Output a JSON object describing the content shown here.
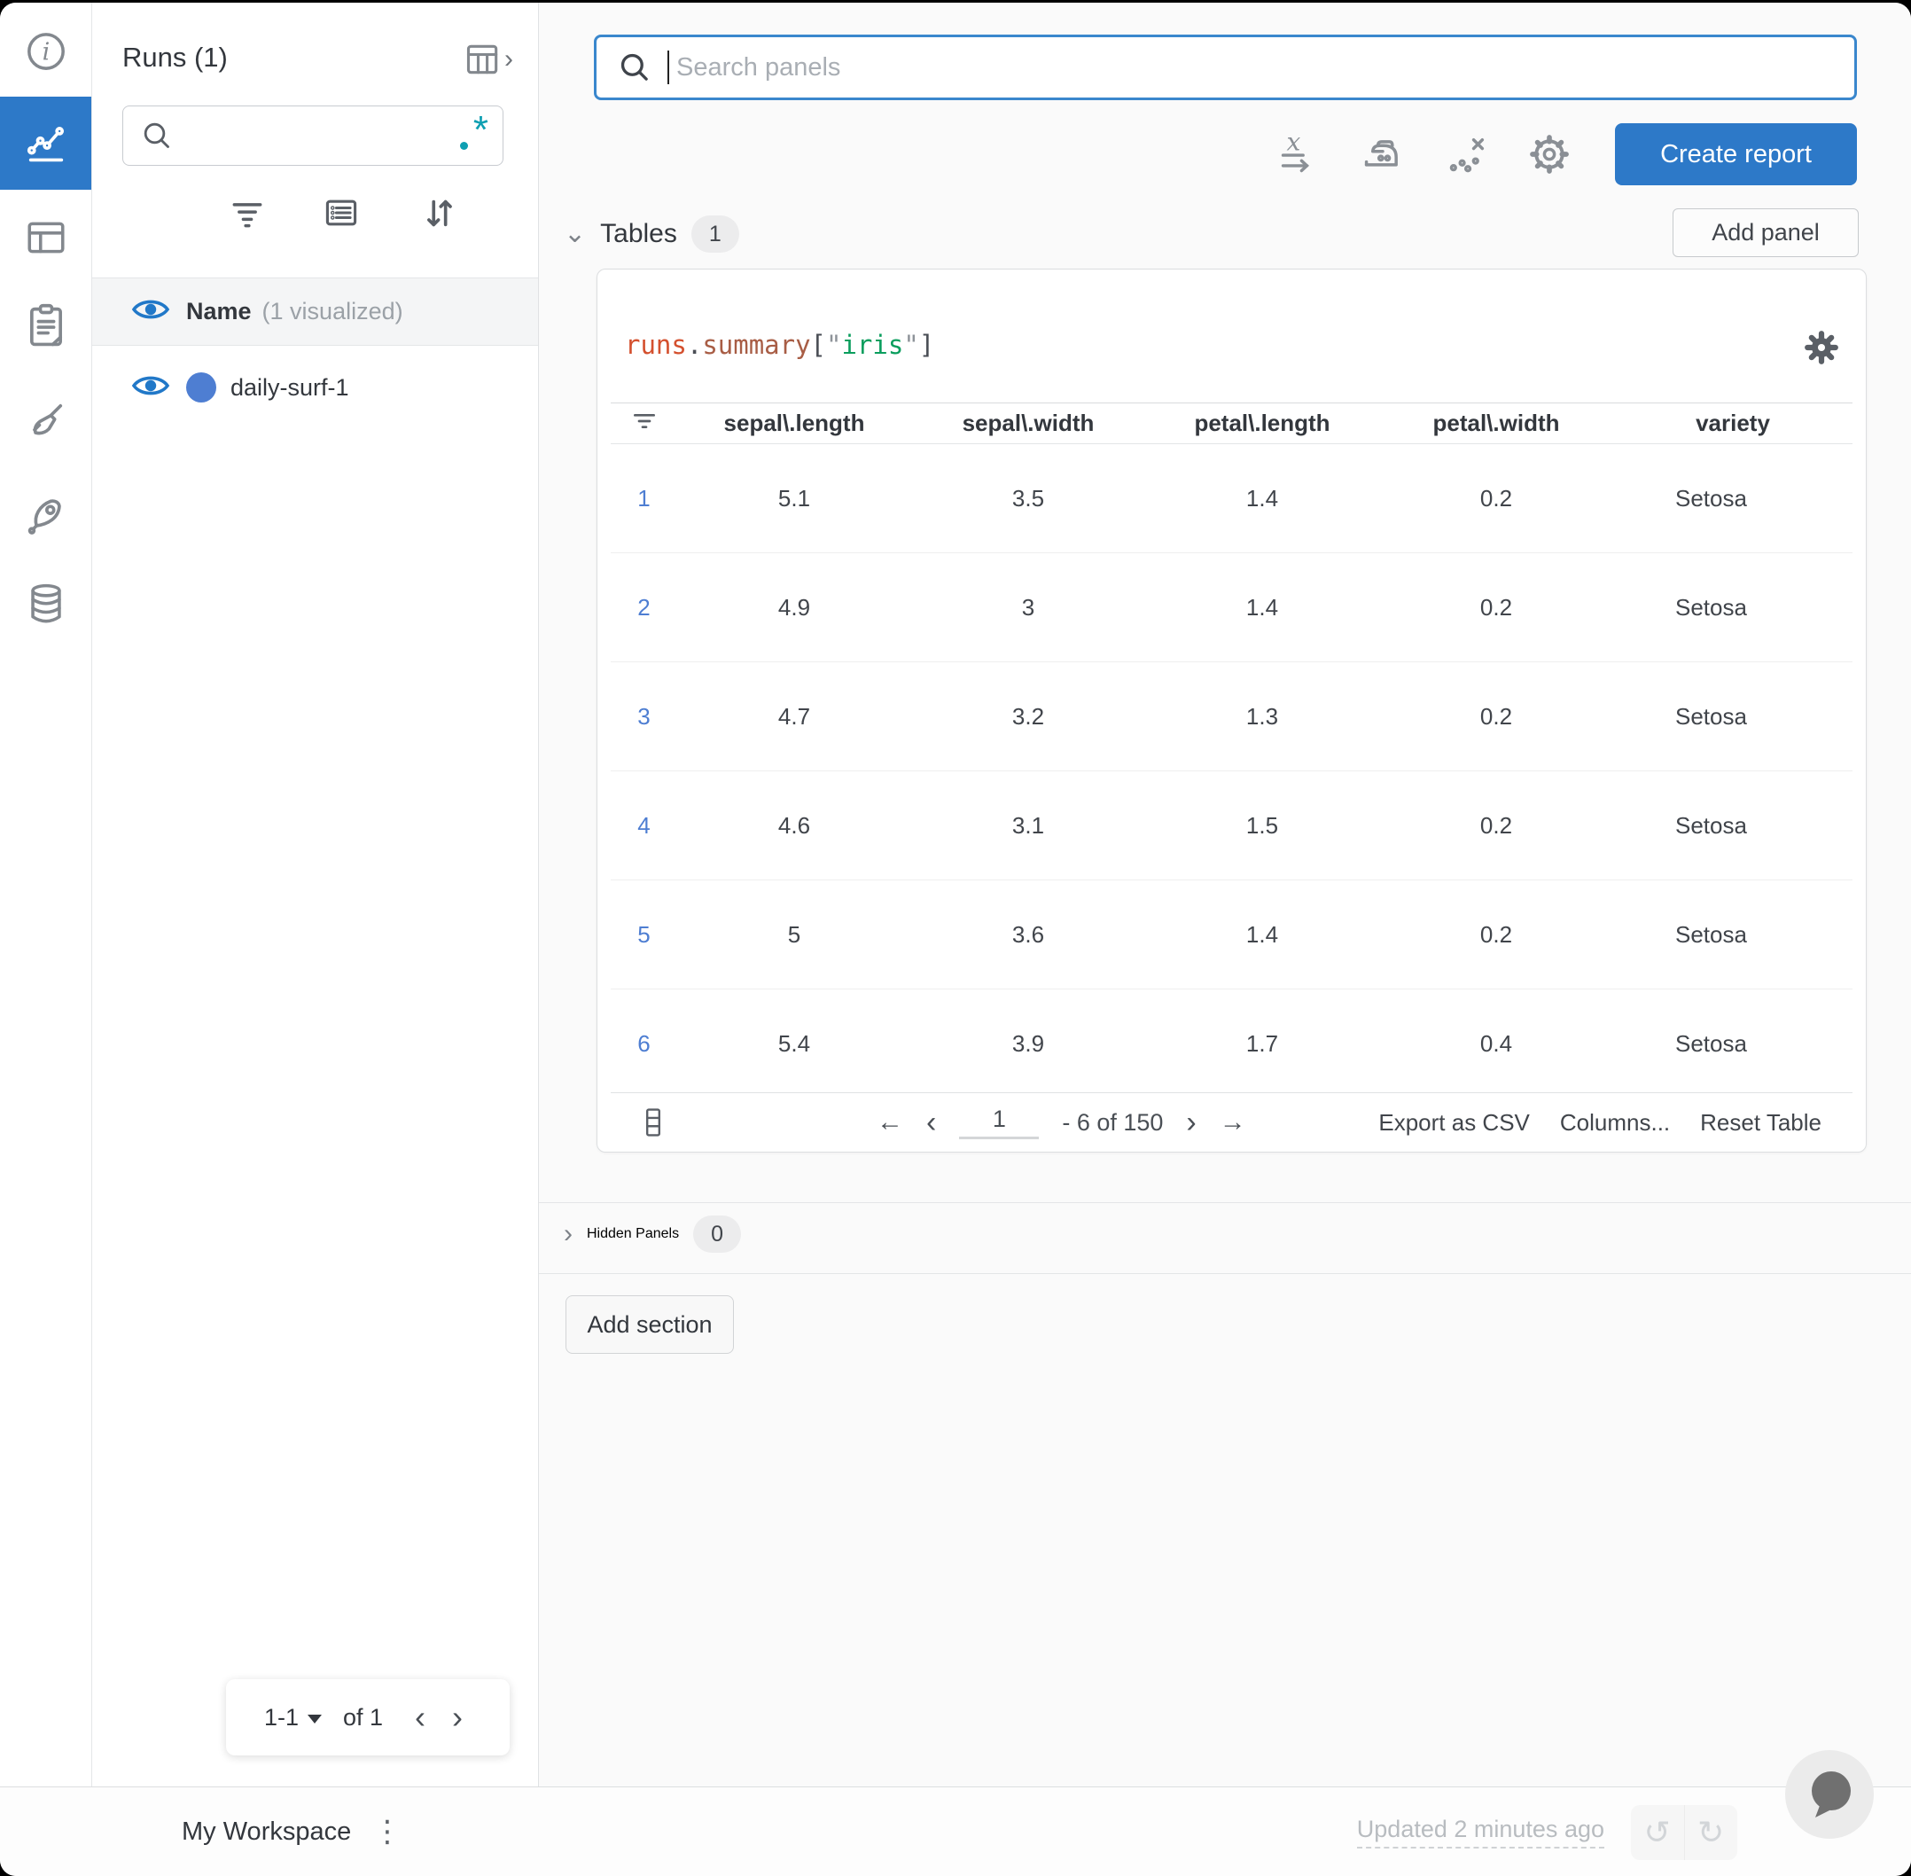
{
  "runs_panel": {
    "title": "Runs (1)",
    "search_value": "",
    "header": {
      "name_label": "Name",
      "visualized_label": "(1 visualized)"
    },
    "runs": [
      {
        "name": "daily-surf-1",
        "color": "#4e7ed2"
      }
    ],
    "pagination": {
      "range": "1-1",
      "of_label": "of 1",
      "prev": "‹",
      "next": "›"
    }
  },
  "toolbar": {
    "search_placeholder": "Search panels",
    "create_report_label": "Create report",
    "add_panel_label": "Add panel"
  },
  "sections": {
    "tables": {
      "label": "Tables",
      "count": "1",
      "chevron": "⌄"
    },
    "hidden": {
      "label": "Hidden Panels",
      "count": "0",
      "chevron": "›"
    },
    "add_section_label": "Add section"
  },
  "table_panel": {
    "title_parts": {
      "obj": "runs",
      "dot": ".",
      "prop": "summary",
      "lbracket": "[",
      "lq": "\"",
      "key": "iris",
      "rq": "\"",
      "rbracket": "]"
    },
    "columns": [
      "sepal\\.length",
      "sepal\\.width",
      "petal\\.length",
      "petal\\.width",
      "variety"
    ],
    "rows": [
      {
        "index": "1",
        "values": [
          "5.1",
          "3.5",
          "1.4",
          "0.2",
          "Setosa"
        ]
      },
      {
        "index": "2",
        "values": [
          "4.9",
          "3",
          "1.4",
          "0.2",
          "Setosa"
        ]
      },
      {
        "index": "3",
        "values": [
          "4.7",
          "3.2",
          "1.3",
          "0.2",
          "Setosa"
        ]
      },
      {
        "index": "4",
        "values": [
          "4.6",
          "3.1",
          "1.5",
          "0.2",
          "Setosa"
        ]
      },
      {
        "index": "5",
        "values": [
          "5",
          "3.6",
          "1.4",
          "0.2",
          "Setosa"
        ]
      },
      {
        "index": "6",
        "values": [
          "5.4",
          "3.9",
          "1.7",
          "0.4",
          "Setosa"
        ]
      }
    ],
    "pagination": {
      "page": "1",
      "range_label": "- 6 of 150",
      "first": "←",
      "prev": "‹",
      "next": "›",
      "last": "→"
    },
    "footer_actions": {
      "export": "Export as CSV",
      "columns": "Columns...",
      "reset": "Reset Table"
    }
  },
  "statusbar": {
    "workspace_label": "My Workspace",
    "updated_label": "Updated 2 minutes ago"
  },
  "colors": {
    "accent_blue": "#2d79c8",
    "link_blue": "#4e7ed2",
    "teal_regex": "#0e9fb2",
    "code_obj": "#d4502e",
    "code_key": "#0b9e5e"
  }
}
